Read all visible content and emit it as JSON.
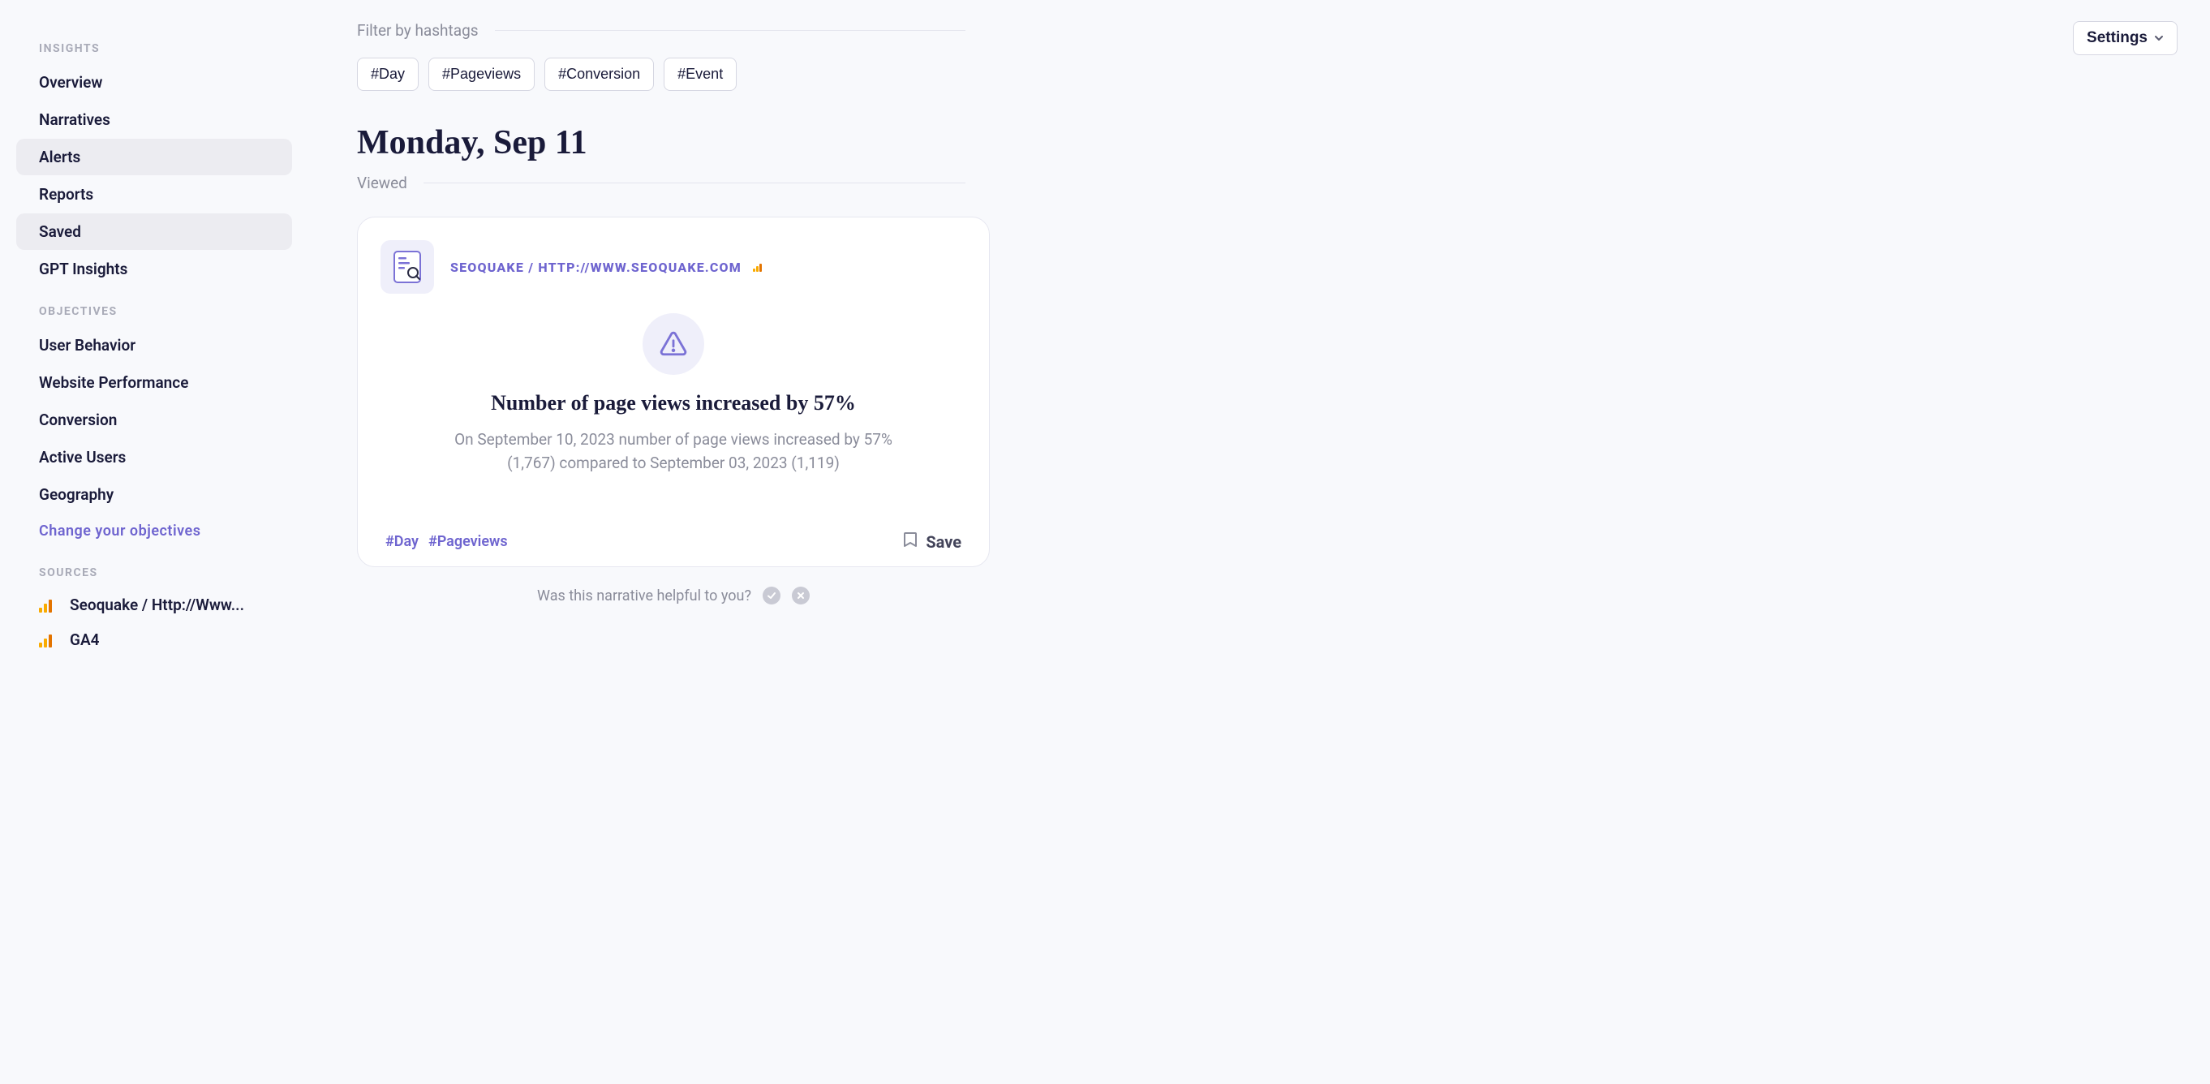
{
  "sidebar": {
    "sections": {
      "insights": {
        "title": "INSIGHTS",
        "items": [
          "Overview",
          "Narratives",
          "Alerts",
          "Reports",
          "Saved",
          "GPT Insights"
        ]
      },
      "objectives": {
        "title": "OBJECTIVES",
        "items": [
          "User Behavior",
          "Website Performance",
          "Conversion",
          "Active Users",
          "Geography"
        ],
        "change_link": "Change your objectives"
      },
      "sources": {
        "title": "SOURCES",
        "items": [
          "Seoquake / Http://Www...",
          "GA4"
        ]
      }
    }
  },
  "main": {
    "filter_label": "Filter by hashtags",
    "hashtags": [
      "#Day",
      "#Pageviews",
      "#Conversion",
      "#Event"
    ],
    "settings_label": "Settings",
    "date_heading": "Monday, Sep 11",
    "status_label": "Viewed"
  },
  "card": {
    "source_label": "SEOQUAKE / HTTP://WWW.SEOQUAKE.COM",
    "title": "Number of page views increased by 57%",
    "description": "On September 10, 2023 number of page views increased by 57% (1,767) compared to September 03, 2023 (1,119)",
    "tags": [
      "#Day",
      "#Pageviews"
    ],
    "save_label": "Save"
  },
  "feedback": {
    "prompt": "Was this narrative helpful to you?"
  }
}
